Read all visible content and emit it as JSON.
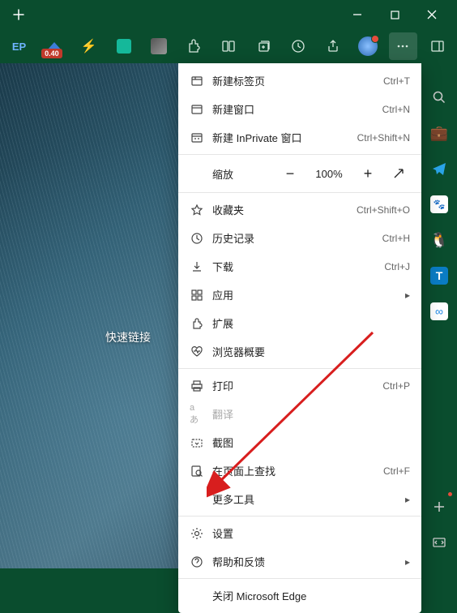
{
  "window": {
    "minimize": "—",
    "maximize": "▢",
    "close": "✕"
  },
  "toolbar": {
    "badge": "0.40"
  },
  "content": {
    "quick_links": "快速链接"
  },
  "menu": {
    "new_tab": "新建标签页",
    "new_tab_sc": "Ctrl+T",
    "new_window": "新建窗口",
    "new_window_sc": "Ctrl+N",
    "new_inprivate": "新建 InPrivate 窗口",
    "new_inprivate_sc": "Ctrl+Shift+N",
    "zoom": "缩放",
    "zoom_val": "100%",
    "favorites": "收藏夹",
    "favorites_sc": "Ctrl+Shift+O",
    "history": "历史记录",
    "history_sc": "Ctrl+H",
    "downloads": "下载",
    "downloads_sc": "Ctrl+J",
    "apps": "应用",
    "extensions": "扩展",
    "browser_essentials": "浏览器概要",
    "print": "打印",
    "print_sc": "Ctrl+P",
    "translate": "翻译",
    "screenshot": "截图",
    "find": "在页面上查找",
    "find_sc": "Ctrl+F",
    "more_tools": "更多工具",
    "settings": "设置",
    "help": "帮助和反馈",
    "close_edge": "关闭 Microsoft Edge"
  }
}
